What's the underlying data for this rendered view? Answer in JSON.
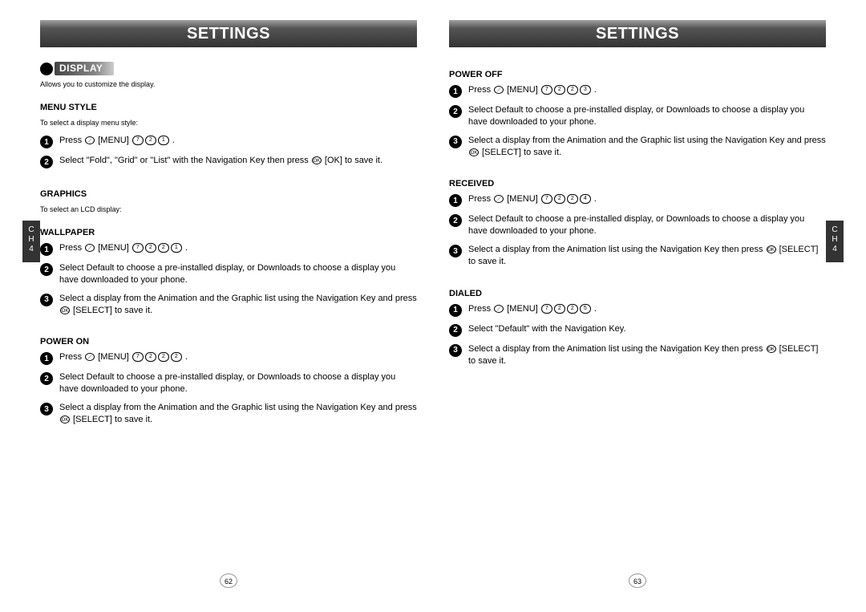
{
  "left": {
    "title": "SETTINGS",
    "display_badge": "DISPLAY",
    "display_desc": "Allows you to customize the display.",
    "menu_style": {
      "heading": "MENU STYLE",
      "desc": "To select a display menu style:",
      "step1_prefix": "Press ",
      "step1_menu": " [MENU] ",
      "step1_keys": [
        "7",
        "2",
        "1"
      ],
      "step1_end": " .",
      "step2": "Select \"Fold\", \"Grid\" or \"List\" with the Navigation Key then press ",
      "step2_ok": " [OK] to save it."
    },
    "graphics": {
      "heading": "GRAPHICS",
      "desc": "To select an LCD display:"
    },
    "wallpaper": {
      "heading": "WALLPAPER",
      "step1_prefix": "Press ",
      "step1_menu": " [MENU] ",
      "step1_keys": [
        "7",
        "2",
        "2",
        "1"
      ],
      "step2": "Select Default to choose a pre-installed display, or Downloads to choose a display you have downloaded to your phone.",
      "step3a": "Select a display from the Animation and the Graphic list using the Navigation Key and press ",
      "step3b": " [SELECT] to save it."
    },
    "power_on": {
      "heading": "POWER ON",
      "step1_prefix": "Press ",
      "step1_menu": " [MENU] ",
      "step1_keys": [
        "7",
        "2",
        "2",
        "2"
      ],
      "step2": "Select Default to choose a pre-installed display, or Downloads to choose a display you have downloaded to your phone.",
      "step3a": "Select a display from the Animation and the Graphic list using the Navigation Key and press ",
      "step3b": " [SELECT] to save it."
    },
    "page_num": "62",
    "tab_ch": "C\nH",
    "tab_num": "4"
  },
  "right": {
    "title": "SETTINGS",
    "power_off": {
      "heading": "POWER OFF",
      "step1_prefix": "Press ",
      "step1_menu": " [MENU] ",
      "step1_keys": [
        "7",
        "2",
        "2",
        "3"
      ],
      "step2": "Select Default to choose a pre-installed display, or Downloads to choose a display you have downloaded to your phone.",
      "step3a": "Select a display from the Animation and the Graphic list using the Navigation Key and press ",
      "step3b": " [SELECT] to save it."
    },
    "received": {
      "heading": "RECEIVED",
      "step1_prefix": "Press ",
      "step1_menu": " [MENU] ",
      "step1_keys": [
        "7",
        "2",
        "2",
        "4"
      ],
      "step2": "Select Default to choose a pre-installed display, or Downloads to choose a display you have downloaded to your phone.",
      "step3a": "Select a display from the Animation list using the Navigation Key then press ",
      "step3b": " [SELECT] to save it."
    },
    "dialed": {
      "heading": "DIALED",
      "step1_prefix": "Press ",
      "step1_menu": " [MENU] ",
      "step1_keys": [
        "7",
        "2",
        "2",
        "5"
      ],
      "step2": "Select \"Default\" with the Navigation Key.",
      "step3a": "Select a display from the Animation list using the Navigation Key then press ",
      "step3b": " [SELECT] to save it."
    },
    "page_num": "63",
    "tab_ch": "C\nH",
    "tab_num": "4"
  },
  "key_labels": {
    "ok": "OK",
    "soft": "⟋"
  }
}
